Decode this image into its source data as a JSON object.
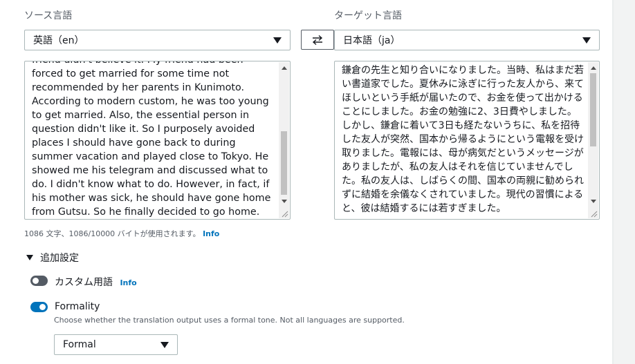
{
  "source": {
    "label": "ソース言語",
    "language": "英語（en）",
    "text": "friend didn't believe it. My friend had been forced to get married for some time not recommended by her parents in Kunimoto. According to modern custom, he was too young to get married. Also, the essential person in question didn't like it. So I purposely avoided places I should have gone back to during summer vacation and played close to Tokyo. He showed me his telegram and discussed what to do. I didn't know what to do. However, in fact, if his mother was sick, he should have gone home from Gutsu. So he finally decided to go home. Having come all the way, I was left alone."
  },
  "target": {
    "label": "ターゲット言語",
    "language": "日本語（ja）",
    "text": "鎌倉の先生と知り合いになりました。当時、私はまだ若い書道家でした。夏休みに泳ぎに行った友人から、来てほしいという手紙が届いたので、お金を使って出かけることにしました。お金の勉強に2、3日費やしました。しかし、鎌倉に着いて3日も経たないうちに、私を招待した友人が突然、国本から帰るようにという電報を受け取りました。電報には、母が病気だというメッセージがありましたが、私の友人はそれを信じていませんでした。私の友人は、しばらくの間、国本の両親に勧められずに結婚を余儀なくされていました。現代の習慣によると、彼は結婚するには若すぎました。"
  },
  "swap_icon": "swap-arrows-icon",
  "count": {
    "text": "1086 文字、1086/10000 バイトが使用されます。",
    "info": "Info"
  },
  "additional_settings": {
    "title": "追加設定",
    "custom_terminology": {
      "label": "カスタム用語",
      "info": "Info",
      "enabled": false
    },
    "formality": {
      "label": "Formality",
      "enabled": true,
      "description": "Choose whether the translation output uses a formal tone. Not all languages are supported.",
      "value": "Formal"
    }
  },
  "colors": {
    "accent": "#0073bb",
    "text": "#16191f",
    "muted": "#545b64",
    "border": "#aab7b8"
  }
}
